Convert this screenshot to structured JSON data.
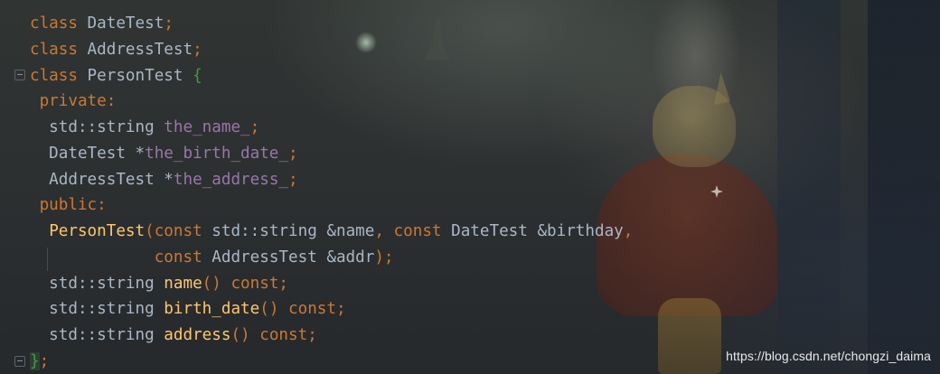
{
  "editor": {
    "language": "C++",
    "lines": [
      [
        {
          "text": "class",
          "kind": "keyword"
        },
        {
          "text": " DateTest",
          "kind": "identifier"
        },
        {
          "text": ";",
          "kind": "keyword"
        }
      ],
      [
        {
          "text": "class",
          "kind": "keyword"
        },
        {
          "text": " AddressTest",
          "kind": "identifier"
        },
        {
          "text": ";",
          "kind": "keyword"
        }
      ],
      [
        {
          "text": "class",
          "kind": "keyword"
        },
        {
          "text": " PersonTest ",
          "kind": "identifier"
        },
        {
          "text": "{",
          "kind": "brace"
        }
      ],
      [
        {
          "text": " private",
          "kind": "keyword"
        },
        {
          "text": ":",
          "kind": "keyword"
        }
      ],
      [
        {
          "text": "  std::string ",
          "kind": "identifier"
        },
        {
          "text": "the_name_",
          "kind": "field"
        },
        {
          "text": ";",
          "kind": "keyword"
        }
      ],
      [
        {
          "text": "  DateTest *",
          "kind": "identifier"
        },
        {
          "text": "the_birth_date_",
          "kind": "field"
        },
        {
          "text": ";",
          "kind": "keyword"
        }
      ],
      [
        {
          "text": "  AddressTest *",
          "kind": "identifier"
        },
        {
          "text": "the_address_",
          "kind": "field"
        },
        {
          "text": ";",
          "kind": "keyword"
        }
      ],
      [
        {
          "text": " public",
          "kind": "keyword"
        },
        {
          "text": ":",
          "kind": "keyword"
        }
      ],
      [
        {
          "text": "  ",
          "kind": "identifier"
        },
        {
          "text": "PersonTest",
          "kind": "function"
        },
        {
          "text": "(",
          "kind": "keyword"
        },
        {
          "text": "const",
          "kind": "keyword"
        },
        {
          "text": " std::string &name",
          "kind": "identifier"
        },
        {
          "text": ", ",
          "kind": "keyword"
        },
        {
          "text": "const",
          "kind": "keyword"
        },
        {
          "text": " DateTest &birthday",
          "kind": "identifier"
        },
        {
          "text": ",",
          "kind": "keyword"
        }
      ],
      [
        {
          "text": "             ",
          "kind": "identifier"
        },
        {
          "text": "const",
          "kind": "keyword"
        },
        {
          "text": " AddressTest &addr",
          "kind": "identifier"
        },
        {
          "text": ");",
          "kind": "keyword"
        }
      ],
      [
        {
          "text": "  std::string ",
          "kind": "identifier"
        },
        {
          "text": "name",
          "kind": "function"
        },
        {
          "text": "() ",
          "kind": "keyword"
        },
        {
          "text": "const",
          "kind": "keyword"
        },
        {
          "text": ";",
          "kind": "keyword"
        }
      ],
      [
        {
          "text": "  std::string ",
          "kind": "identifier"
        },
        {
          "text": "birth_date",
          "kind": "function"
        },
        {
          "text": "() ",
          "kind": "keyword"
        },
        {
          "text": "const",
          "kind": "keyword"
        },
        {
          "text": ";",
          "kind": "keyword"
        }
      ],
      [
        {
          "text": "  std::string ",
          "kind": "identifier"
        },
        {
          "text": "address",
          "kind": "function"
        },
        {
          "text": "() ",
          "kind": "keyword"
        },
        {
          "text": "const",
          "kind": "keyword"
        },
        {
          "text": ";",
          "kind": "keyword"
        }
      ],
      [
        {
          "text": "}",
          "kind": "brace-close"
        },
        {
          "text": ";",
          "kind": "keyword"
        }
      ]
    ]
  },
  "watermark": {
    "text": "https://blog.csdn.net/chongzi_daima"
  },
  "theme": {
    "keyword": "#cc7832",
    "identifier": "#a9b7c6",
    "field": "#9876aa",
    "function": "#ffc66d",
    "brace": "#3ca03c",
    "background": "#2b2d2f"
  },
  "icons": {
    "fold_open": "fold-collapse-icon",
    "fold_close": "fold-end-icon"
  }
}
